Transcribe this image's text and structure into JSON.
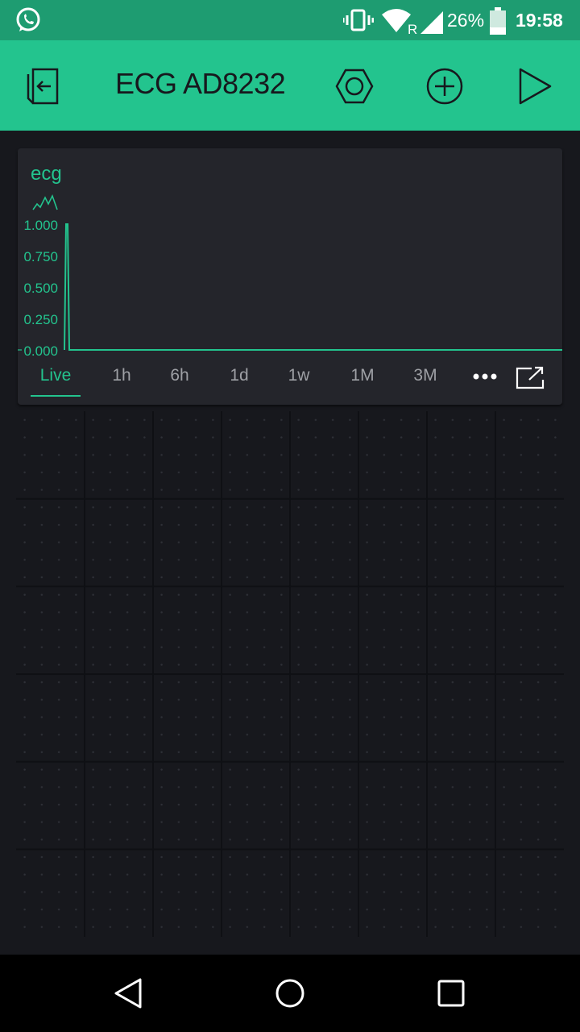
{
  "status_bar": {
    "battery_percent": "26%",
    "time": "19:58",
    "icons": [
      "whatsapp-icon",
      "vibrate-icon",
      "wifi-icon",
      "roaming-signal-icon",
      "battery-icon"
    ]
  },
  "header": {
    "title": "ECG AD8232",
    "icons": [
      "exit-icon",
      "settings-hexagon-icon",
      "add-circle-icon",
      "play-icon"
    ]
  },
  "widget": {
    "name": "ecg",
    "tabs": [
      {
        "label": "Live",
        "active": true
      },
      {
        "label": "1h"
      },
      {
        "label": "6h"
      },
      {
        "label": "1d"
      },
      {
        "label": "1w"
      },
      {
        "label": "1M"
      },
      {
        "label": "3M"
      }
    ],
    "more_icon": "more-dots-icon",
    "expand_icon": "expand-icon"
  },
  "chart_data": {
    "type": "line",
    "series": [
      {
        "name": "ecg",
        "color": "#23c48e",
        "x": [
          0,
          0.5,
          1,
          1.5,
          2,
          2.5,
          3,
          4,
          5,
          6,
          7,
          8,
          9,
          10
        ],
        "values": [
          0,
          1,
          1,
          0,
          0,
          0,
          0,
          0,
          0,
          0,
          0,
          0,
          0,
          0
        ]
      }
    ],
    "ytick_labels": [
      "1.000",
      "0.750",
      "0.500",
      "0.250",
      "0.000"
    ],
    "ylim": [
      0,
      1
    ],
    "grid": false
  },
  "colors": {
    "accent": "#23c48e",
    "status_bar": "#1e9c71",
    "background": "#17181d",
    "widget": "#24252b"
  },
  "nav_bar": {
    "icons": [
      "back-icon",
      "home-icon",
      "recents-icon"
    ]
  }
}
